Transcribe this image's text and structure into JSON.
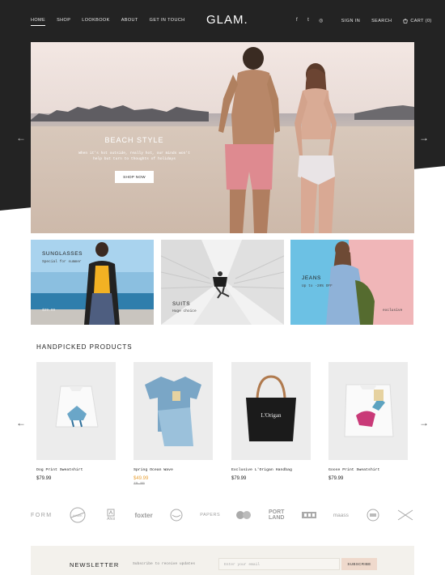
{
  "header": {
    "logo": "GLAM.",
    "nav": [
      "HOME",
      "SHOP",
      "LOOKBOOK",
      "ABOUT",
      "GET IN TOUCH"
    ],
    "social_icons": [
      "facebook-icon",
      "twitter-icon",
      "instagram-icon"
    ],
    "social_glyphs": [
      "f",
      "t",
      "◎"
    ],
    "sign_in": "SIGN IN",
    "search": "SEARCH",
    "cart": "CART (0)"
  },
  "hero": {
    "title": "BEACH STYLE",
    "subtitle_line1": "When it's hot outside, really hot, our minds won't",
    "subtitle_line2": "help but turn to thoughts of holidays",
    "button": "SHOP NOW",
    "prev_arrow": "←",
    "next_arrow": "→"
  },
  "categories": [
    {
      "title": "SUNGLASSES",
      "sub": "Special for summer",
      "extra": "$29.99"
    },
    {
      "title": "SUITS",
      "sub": "Huge choice"
    },
    {
      "title": "JEANS",
      "sub": "Up to -20% OFF",
      "extra": "exclusive"
    }
  ],
  "products_section": {
    "title": "HANDPICKED PRODUCTS",
    "prev_arrow": "←",
    "next_arrow": "→",
    "items": [
      {
        "name": "Dog Print Sweatshirt",
        "price": "$79.99"
      },
      {
        "name": "Spring Ocean Wave",
        "price": "$49.99",
        "old_price": "79.99"
      },
      {
        "name": "Exclusive L'Origan Handbag",
        "price": "$79.99",
        "bag_label": "L'Origan"
      },
      {
        "name": "Goose Print Sweatshirt",
        "price": "$79.99"
      }
    ]
  },
  "brands": [
    "FORM",
    "HAWK",
    "Ahoi",
    "foxter",
    "O",
    "PAPERS",
    "",
    "PORT LAND",
    "",
    "maass",
    "",
    ""
  ],
  "newsletter": {
    "title": "NEWSLETTER",
    "subtitle": "Subscribe to receive updates",
    "placeholder": "Enter your email",
    "button": "SUBSCRIBE"
  },
  "colors": {
    "header_bg": "#232323",
    "accent_price": "#e8a23a",
    "newsletter_bg": "#f3f1ec",
    "subscribe_bg": "#efd9cc"
  }
}
